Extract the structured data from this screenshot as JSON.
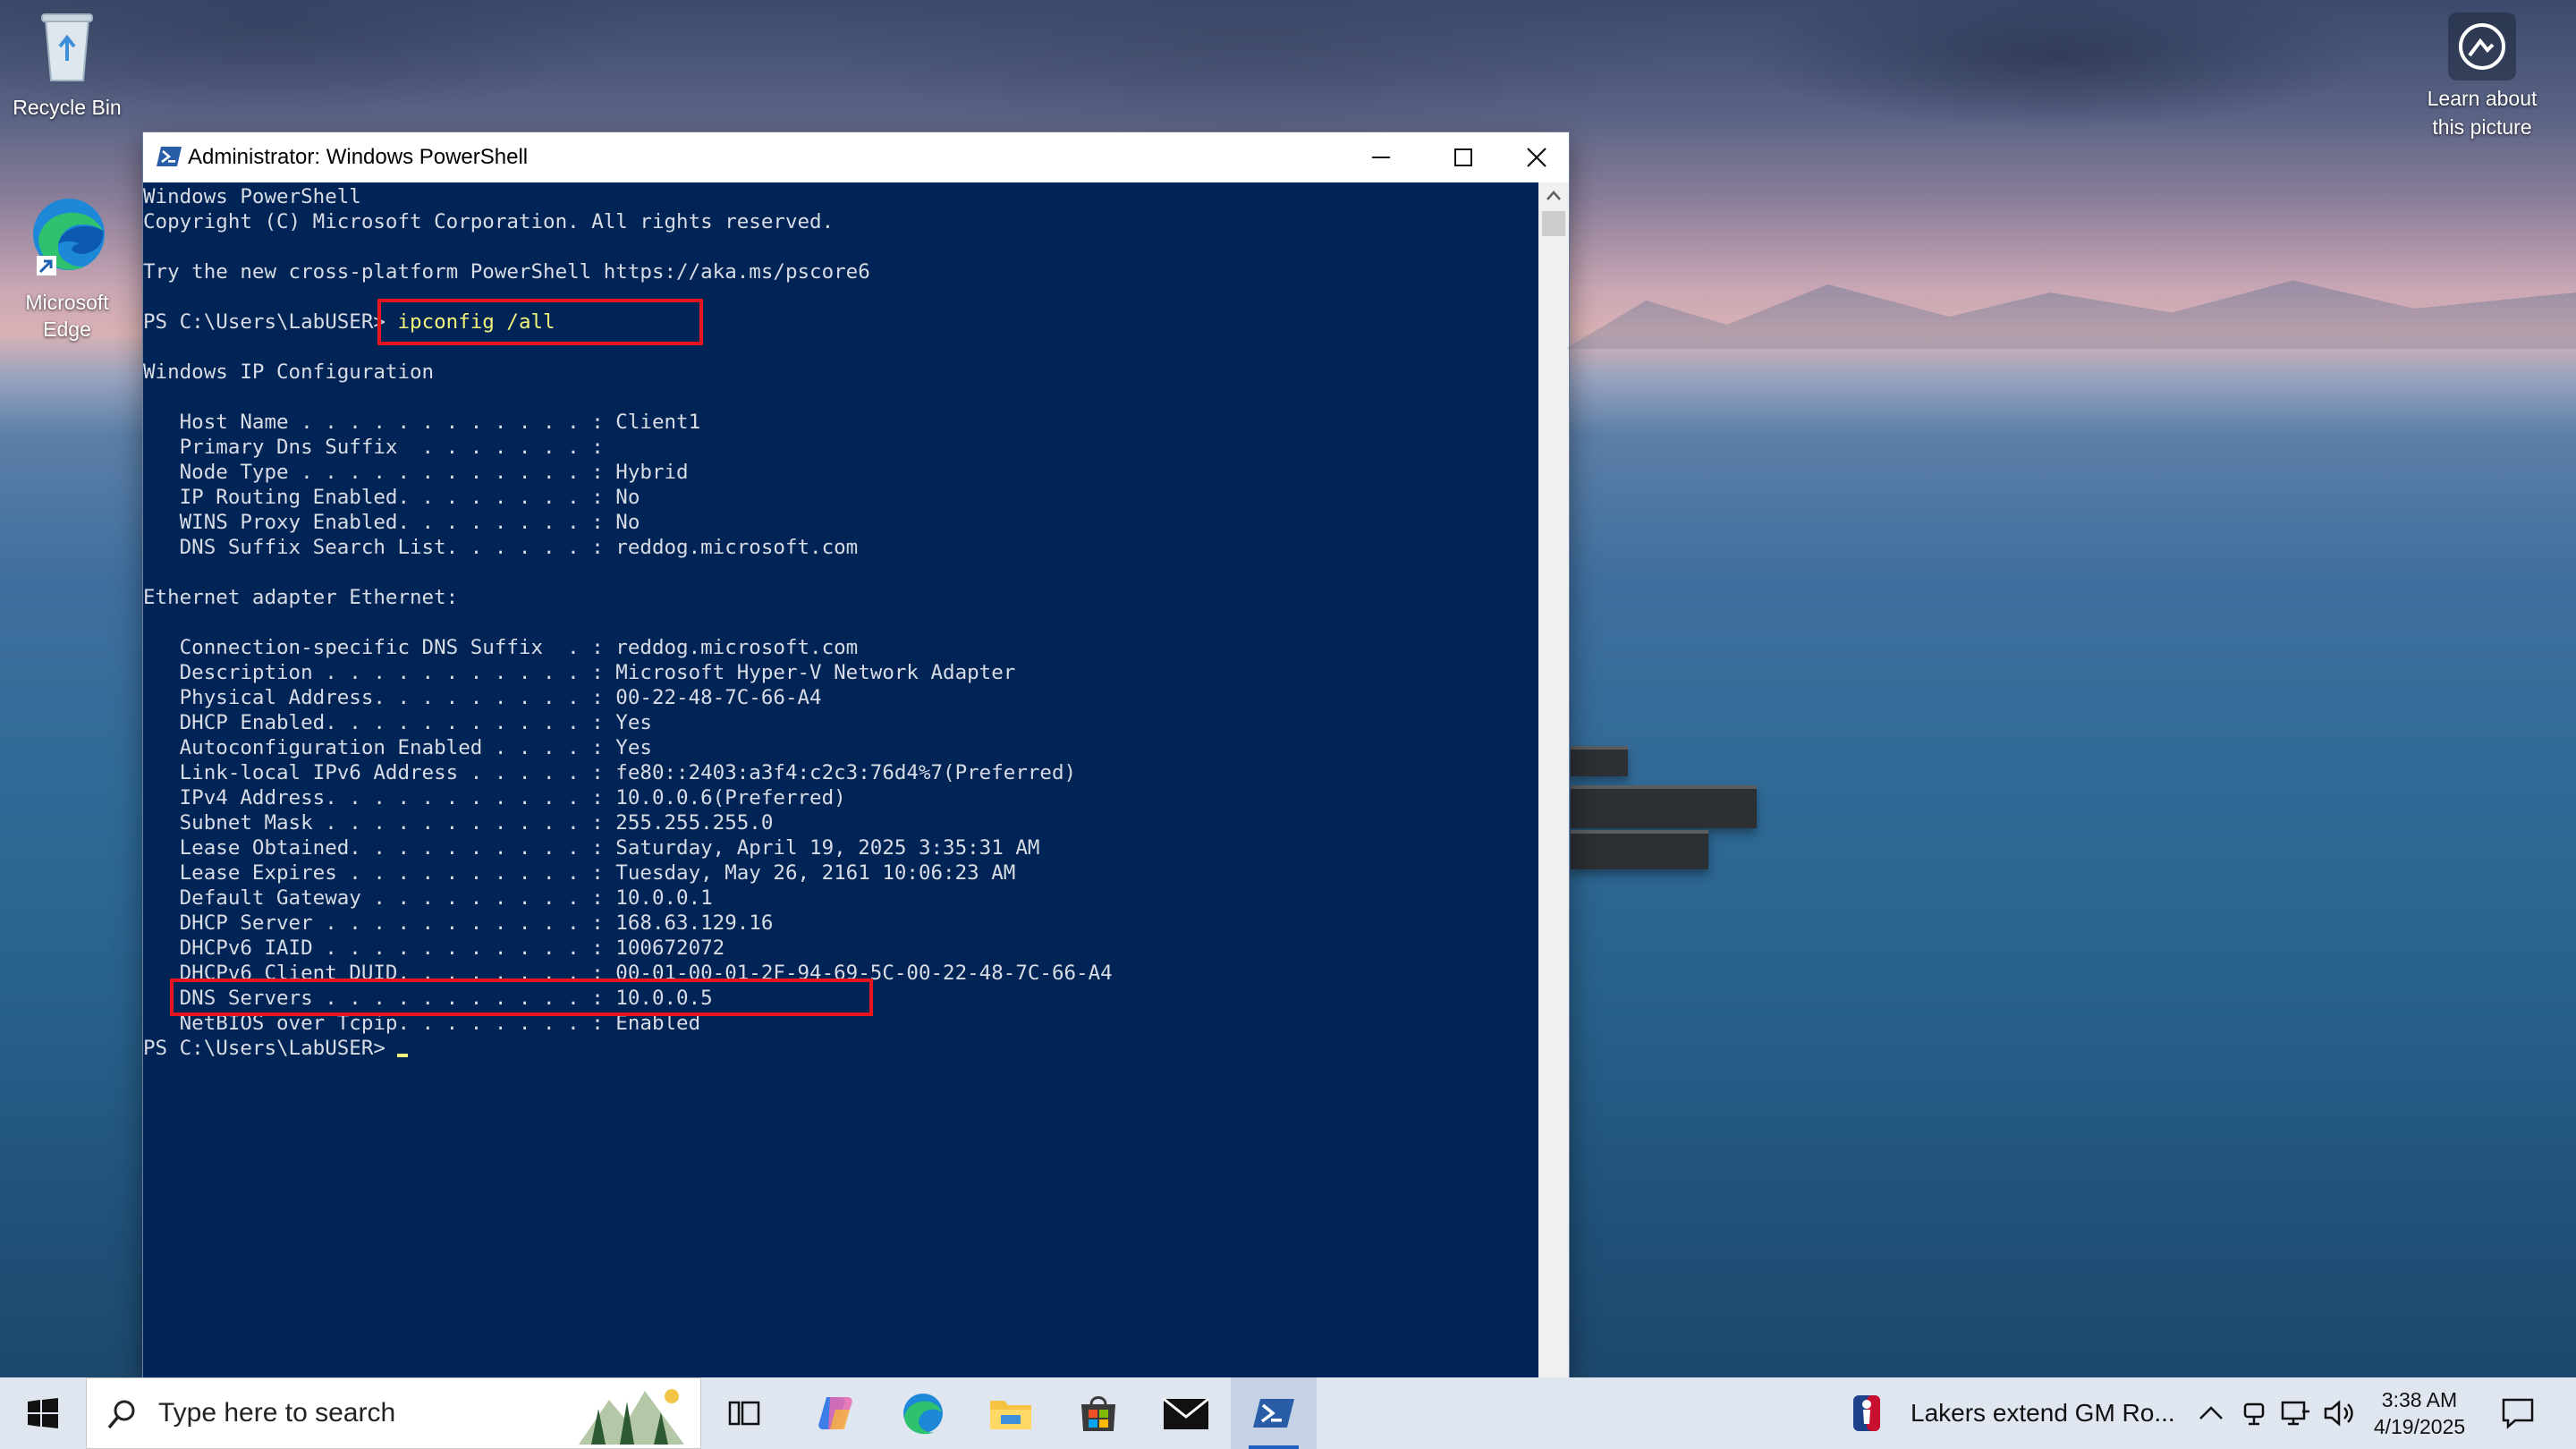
{
  "desktop": {
    "icons": [
      {
        "label": "Recycle Bin"
      },
      {
        "label": "Microsoft Edge"
      }
    ],
    "learn_about": "Learn about this picture"
  },
  "window": {
    "title": "Administrator: Windows PowerShell",
    "console_lines": [
      "Windows PowerShell",
      "Copyright (C) Microsoft Corporation. All rights reserved.",
      "",
      "Try the new cross-platform PowerShell https://aka.ms/pscore6",
      "",
      "__PROMPT_CMD__",
      "",
      "Windows IP Configuration",
      "",
      "   Host Name . . . . . . . . . . . . : Client1",
      "   Primary Dns Suffix  . . . . . . . :",
      "   Node Type . . . . . . . . . . . . : Hybrid",
      "   IP Routing Enabled. . . . . . . . : No",
      "   WINS Proxy Enabled. . . . . . . . : No",
      "   DNS Suffix Search List. . . . . . : reddog.microsoft.com",
      "",
      "Ethernet adapter Ethernet:",
      "",
      "   Connection-specific DNS Suffix  . : reddog.microsoft.com",
      "   Description . . . . . . . . . . . : Microsoft Hyper-V Network Adapter",
      "   Physical Address. . . . . . . . . : 00-22-48-7C-66-A4",
      "   DHCP Enabled. . . . . . . . . . . : Yes",
      "   Autoconfiguration Enabled . . . . : Yes",
      "   Link-local IPv6 Address . . . . . : fe80::2403:a3f4:c2c3:76d4%7(Preferred)",
      "   IPv4 Address. . . . . . . . . . . : 10.0.0.6(Preferred)",
      "   Subnet Mask . . . . . . . . . . . : 255.255.255.0",
      "   Lease Obtained. . . . . . . . . . : Saturday, April 19, 2025 3:35:31 AM",
      "   Lease Expires . . . . . . . . . . : Tuesday, May 26, 2161 10:06:23 AM",
      "   Default Gateway . . . . . . . . . : 10.0.0.1",
      "   DHCP Server . . . . . . . . . . . : 168.63.129.16",
      "   DHCPv6 IAID . . . . . . . . . . . : 100672072",
      "   DHCPv6 Client DUID. . . . . . . . : 00-01-00-01-2F-94-69-5C-00-22-48-7C-66-A4",
      "   DNS Servers . . . . . . . . . . . : 10.0.0.5",
      "   NetBIOS over Tcpip. . . . . . . . : Enabled",
      "__PROMPT_CURSOR__"
    ],
    "prompt": "PS C:\\Users\\LabUSER> ",
    "command": "ipconfig /all"
  },
  "taskbar": {
    "search_placeholder": "Type here to search",
    "news": "Lakers extend GM Ro...",
    "time": "3:38 AM",
    "date": "4/19/2025"
  },
  "colors": {
    "console_bg": "#012456",
    "command": "#f3f27a",
    "highlight": "#e8141e"
  }
}
